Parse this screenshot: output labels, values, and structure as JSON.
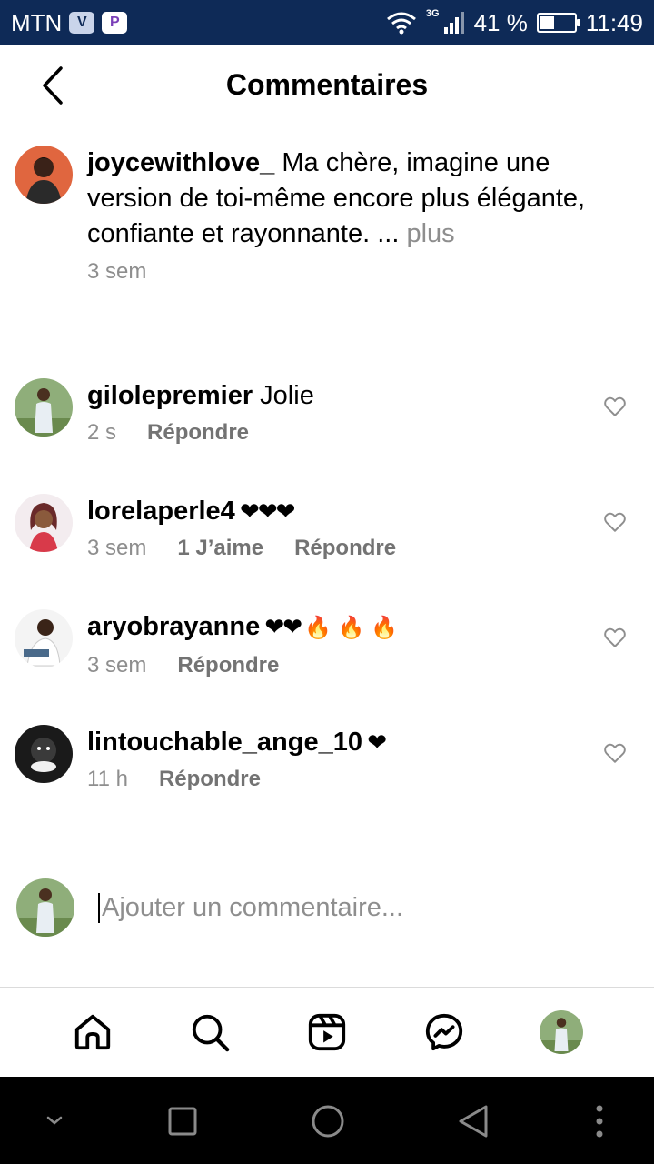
{
  "status_bar": {
    "carrier": "MTN",
    "badge_v": "V",
    "badge_p": "P",
    "network": "3G",
    "battery_percent": "41 %",
    "battery_level": 0.41,
    "time": "11:49"
  },
  "header": {
    "title": "Commentaires"
  },
  "caption": {
    "username": "joycewithlove_",
    "text": " Ma chère, imagine une version de toi-même encore plus élégante, confiante et rayonnante. ... ",
    "more": "plus",
    "time": "3 sem"
  },
  "comments": [
    {
      "username": "gilolepremier",
      "text": " Jolie",
      "time": "2 s",
      "reply": "Répondre"
    },
    {
      "username": "lorelaperle4",
      "text": " ❤❤❤",
      "time": "3 sem",
      "likes": "1 J’aime",
      "reply": "Répondre"
    },
    {
      "username": "aryobrayanne",
      "text": " ❤❤",
      "fire": "🔥 🔥 🔥",
      "time": "3 sem",
      "reply": "Répondre"
    },
    {
      "username": "lintouchable_ange_10",
      "text": " ❤",
      "time": "11 h",
      "reply": "Répondre"
    }
  ],
  "add_comment": {
    "placeholder": "Ajouter un commentaire..."
  },
  "icons": {
    "back": "chevron-left-icon",
    "heart": "heart-outline-icon",
    "home": "home-icon",
    "search": "search-icon",
    "reels": "reels-icon",
    "messenger": "messenger-icon"
  }
}
